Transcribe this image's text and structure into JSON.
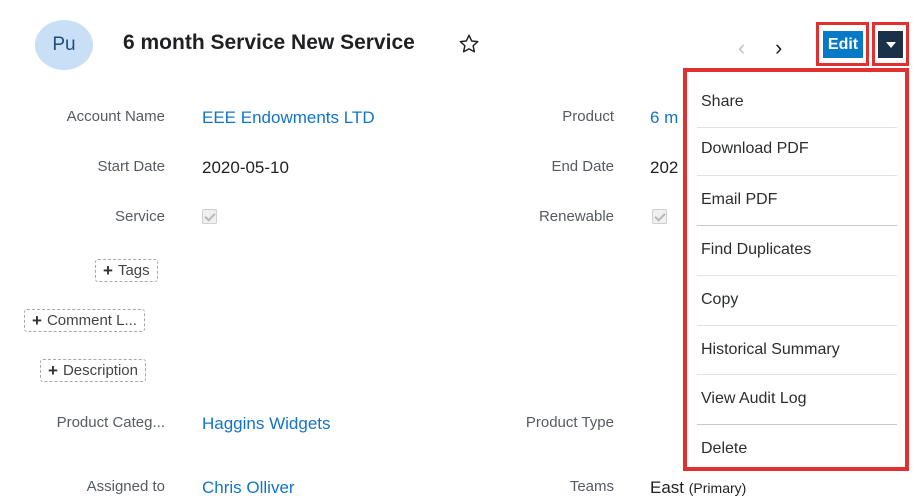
{
  "header": {
    "avatar": "Pu",
    "title": "6 month Service New Service",
    "favorite_icon": "star-outline",
    "edit_label": "Edit",
    "colors": {
      "edit": "#0679c8",
      "caret": "#1a3149",
      "highlight": "#e0302f"
    }
  },
  "fields": {
    "account_name": {
      "label": "Account Name",
      "value": "EEE Endowments LTD"
    },
    "product": {
      "label": "Product",
      "value": "6 m"
    },
    "start_date": {
      "label": "Start Date",
      "value": "2020-05-10"
    },
    "end_date": {
      "label": "End Date",
      "value": "202"
    },
    "service": {
      "label": "Service",
      "checked": true
    },
    "renewable": {
      "label": "Renewable",
      "checked": true
    },
    "tags_button": "Tags",
    "comment_button": "Comment L...",
    "description_button": "Description",
    "product_category": {
      "label": "Product Categ...",
      "value": "Haggins Widgets"
    },
    "product_type": {
      "label": "Product Type"
    },
    "assigned_to": {
      "label": "Assigned to",
      "value": "Chris Olliver"
    },
    "teams": {
      "label": "Teams",
      "value": "East",
      "suffix": "(Primary)"
    }
  },
  "menu": {
    "items": [
      "Share",
      "Download PDF",
      "Email PDF",
      "Find Duplicates",
      "Copy",
      "Historical Summary",
      "View Audit Log",
      "Delete"
    ]
  }
}
